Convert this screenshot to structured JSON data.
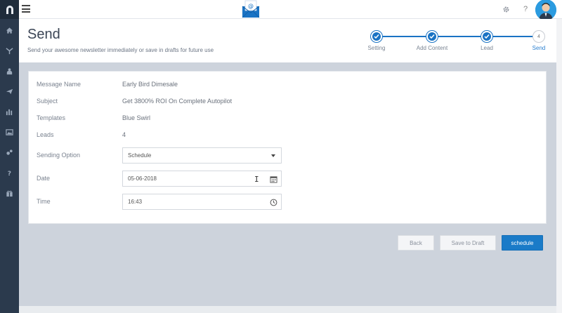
{
  "header": {
    "title": "Send",
    "subtitle": "Send your awesome newsletter immediately or save in drafts for future use"
  },
  "stepper": {
    "steps": [
      {
        "label": "Setting",
        "status": "done"
      },
      {
        "label": "Add Content",
        "status": "done"
      },
      {
        "label": "Lead",
        "status": "done"
      },
      {
        "label": "Send",
        "number": "4",
        "status": "current"
      }
    ]
  },
  "summary": {
    "message_name_label": "Message Name",
    "message_name_value": "Early Bird Dimesale",
    "subject_label": "Subject",
    "subject_value": "Get 3800% ROI On Complete Autopilot",
    "templates_label": "Templates",
    "templates_value": "Blue Swirl",
    "leads_label": "Leads",
    "leads_value": "4"
  },
  "form": {
    "sending_option_label": "Sending Option",
    "sending_option_value": "Schedule",
    "date_label": "Date",
    "date_value": "05-06-2018",
    "time_label": "Time",
    "time_value": "16:43"
  },
  "actions": {
    "back": "Back",
    "save_draft": "Save to Draft",
    "schedule": "schedule"
  },
  "topbar": {
    "help_glyph": "?",
    "settings_icon": "gear-icon"
  },
  "colors": {
    "sidebar": "#2b3a4d",
    "primary": "#1a7bc8",
    "background": "#cdd3dc"
  }
}
